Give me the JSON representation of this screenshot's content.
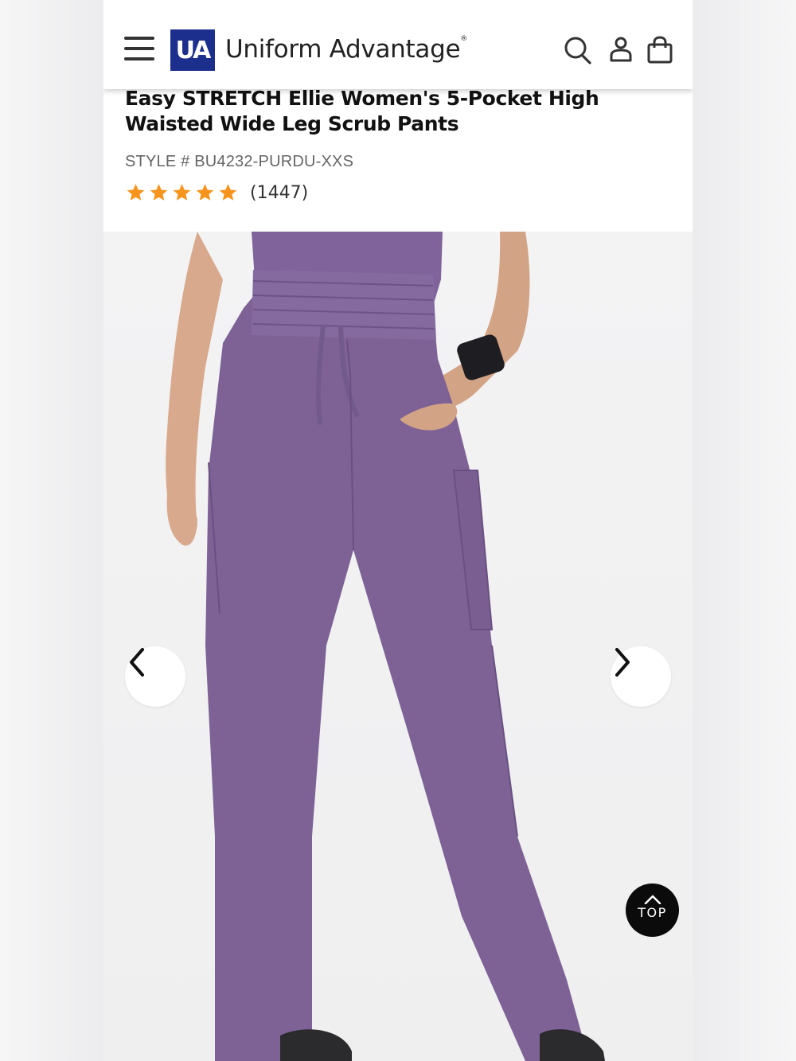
{
  "header": {
    "logo_text": "UA",
    "brand_name": "Uniform Advantage",
    "brand_mark": "®",
    "icons": [
      "menu-icon",
      "search-icon",
      "account-icon",
      "shopping-bag-icon"
    ]
  },
  "product": {
    "title": "Easy STRETCH Ellie Women's 5-Pocket High Waisted Wide Leg Scrub Pants",
    "style_number": "STYLE # BU4232-PURDU-XXS",
    "rating_stars": 5,
    "review_count": "(1447)"
  },
  "gallery": {
    "prev_icon": "chevron-left-icon",
    "next_icon": "chevron-right-icon"
  },
  "back_to_top": {
    "label": "TOP",
    "icon": "chevron-up-icon"
  },
  "colors": {
    "brand_blue": "#1d2f8c",
    "star_orange": "#f7941d",
    "pants_purple": "#7e6296"
  }
}
